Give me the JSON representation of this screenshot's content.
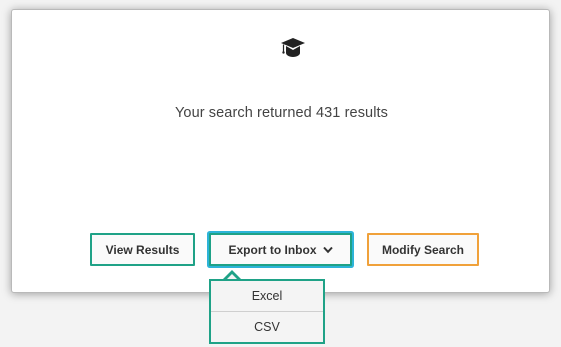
{
  "panel": {
    "icon": "graduation-cap-icon",
    "result_text": "Your search returned 431 results"
  },
  "buttons": {
    "view_results": "View Results",
    "export_to_inbox": "Export to Inbox",
    "export_chevron_icon": "chevron-down-icon",
    "modify_search": "Modify Search"
  },
  "export_menu": {
    "items": [
      "Excel",
      "CSV"
    ]
  },
  "colors": {
    "green_border": "#1fa287",
    "blue_focus": "#2db4d8",
    "orange_border": "#f0a13a",
    "text": "#444444"
  }
}
